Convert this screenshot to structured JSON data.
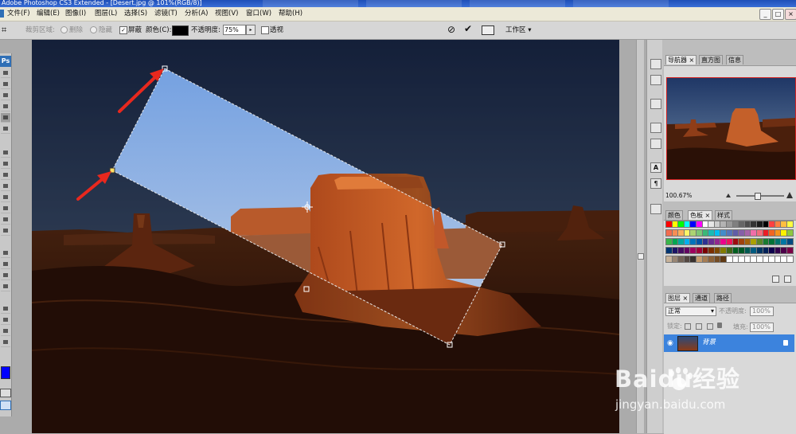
{
  "window": {
    "title": "Adobe Photoshop CS3 Extended - [Desert.jpg @ 101%(RGB/8)]"
  },
  "menu": {
    "items": [
      "文件(F)",
      "编辑(E)",
      "图像(I)",
      "图层(L)",
      "选择(S)",
      "滤镜(T)",
      "分析(A)",
      "视图(V)",
      "窗口(W)",
      "帮助(H)"
    ],
    "window_controls": [
      "_",
      "□",
      "×"
    ]
  },
  "options_bar": {
    "crop_area_label": "裁剪区域:",
    "delete_label": "删除",
    "hide_label": "隐藏",
    "shield_checked": true,
    "shield_label": "屏蔽",
    "color_label": "颜色(C):",
    "shield_color": "#000000",
    "opacity_label": "不透明度:",
    "opacity_value": "75%",
    "perspective_checked": false,
    "perspective_label": "透视",
    "workspace_label": "工作区"
  },
  "toolbox": {
    "logo_text": "Ps",
    "foreground_color": "#0000ff"
  },
  "navigator_panel": {
    "tabs": [
      "导航器",
      "直方图",
      "信息"
    ],
    "zoom_value": "100.67%"
  },
  "swatches_panel": {
    "tabs": [
      "颜色",
      "色板",
      "样式"
    ]
  },
  "layers_panel": {
    "tabs": [
      "图层",
      "通道",
      "路径"
    ],
    "blend_mode": "正常",
    "opacity_label": "不透明度:",
    "opacity_value": "100%",
    "lock_label": "锁定:",
    "fill_label": "填充:",
    "fill_value": "100%",
    "layers": [
      {
        "name": "背景"
      }
    ]
  },
  "watermark": {
    "brand_text": "Baidu经验",
    "url_text": "jingyan.baidu.com"
  },
  "colors": {
    "selection_accent": "#3c83dd",
    "arrow_red": "#e8281e"
  }
}
